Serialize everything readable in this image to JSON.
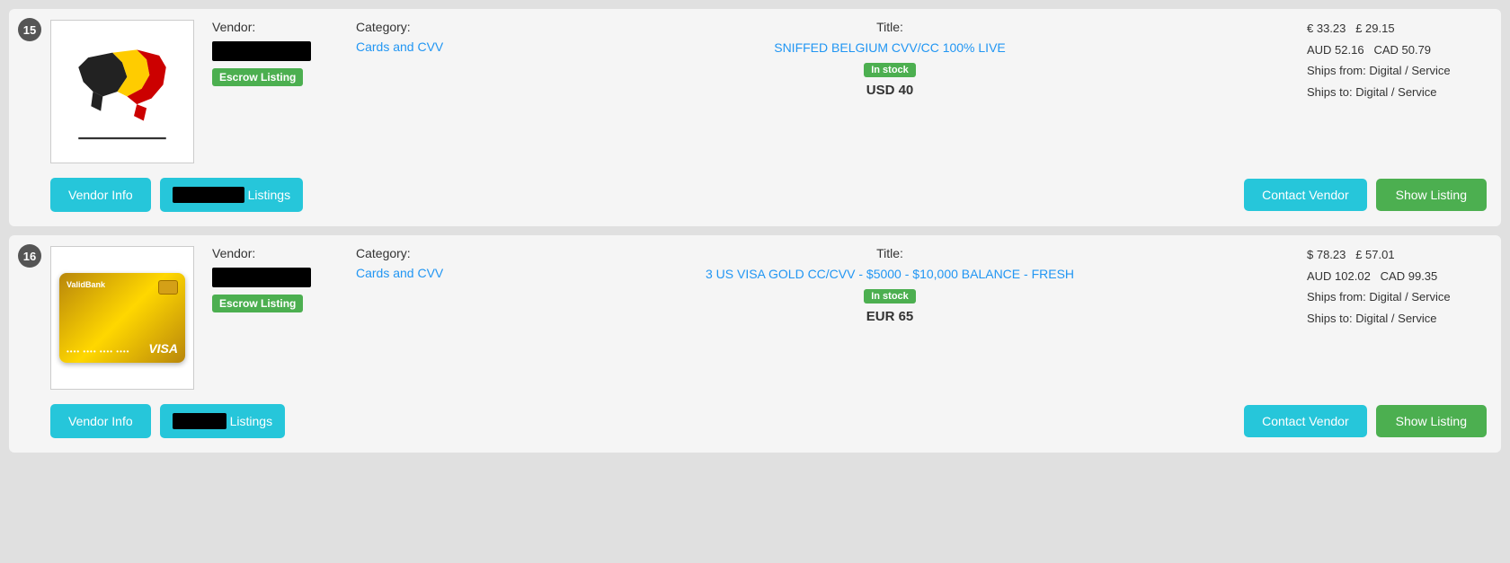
{
  "listings": [
    {
      "number": "15",
      "vendor_label": "Vendor:",
      "category_label": "Category:",
      "title_label": "Title:",
      "category": "Cards and CVV",
      "title": "SNIFFED BELGIUM CVV/CC 100% LIVE",
      "stock_status": "In stock",
      "price_usd": "USD 40",
      "price_eur": "€ 33.23",
      "price_gbp": "£ 29.15",
      "price_aud": "AUD 52.16",
      "price_cad": "CAD 50.79",
      "ships_from": "Ships from: Digital / Service",
      "ships_to": "Ships to: Digital / Service",
      "escrow_label": "Escrow Listing",
      "btn_vendor_info": "Vendor Info",
      "btn_listings": "Listings",
      "btn_contact": "Contact Vendor",
      "btn_show": "Show Listing",
      "image_type": "flag"
    },
    {
      "number": "16",
      "vendor_label": "Vendor:",
      "category_label": "Category:",
      "title_label": "Title:",
      "category": "Cards and CVV",
      "title": "3 US VISA GOLD CC/CVV - $5000 - $10,000 BALANCE - FRESH",
      "stock_status": "In stock",
      "price_usd": "EUR 65",
      "price_eur": "$ 78.23",
      "price_gbp": "£ 57.01",
      "price_aud": "AUD 102.02",
      "price_cad": "CAD 99.35",
      "ships_from": "Ships from: Digital / Service",
      "ships_to": "Ships to: Digital / Service",
      "escrow_label": "Escrow Listing",
      "btn_vendor_info": "Vendor Info",
      "btn_listings": "Listings",
      "btn_contact": "Contact Vendor",
      "btn_show": "Show Listing",
      "image_type": "card"
    }
  ]
}
